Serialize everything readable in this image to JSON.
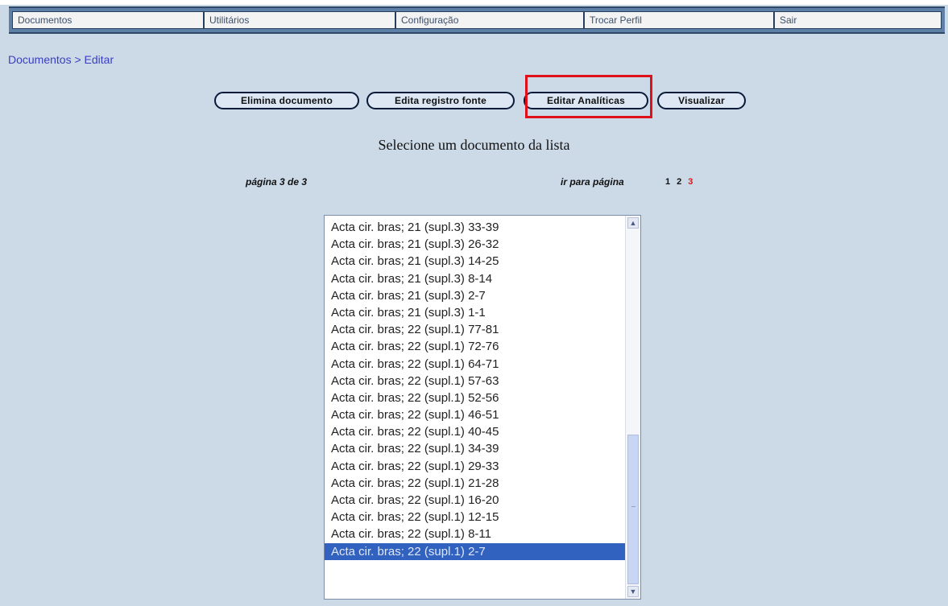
{
  "nav": {
    "items": [
      {
        "label": "Documentos"
      },
      {
        "label": "Utilitários"
      },
      {
        "label": "Configuração"
      },
      {
        "label": "Trocar Perfil"
      },
      {
        "label": "Sair"
      }
    ]
  },
  "breadcrumb": "Documentos > Editar",
  "actions": {
    "delete_label": "Elimina documento",
    "edit_source_label": "Edita registro fonte",
    "edit_analytics_label": "Editar Analíticas",
    "view_label": "Visualizar"
  },
  "heading": "Selecione um documento da lista",
  "pagination": {
    "page_info": "página 3 de 3",
    "goto_label": "ir para página",
    "pages": [
      "1",
      "2",
      "3"
    ],
    "current": "3"
  },
  "list": {
    "items": [
      "Acta cir. bras; 21 (supl.3) 33-39",
      "Acta cir. bras; 21 (supl.3) 26-32",
      "Acta cir. bras; 21 (supl.3) 14-25",
      "Acta cir. bras; 21 (supl.3) 8-14",
      "Acta cir. bras; 21 (supl.3) 2-7",
      "Acta cir. bras; 21 (supl.3) 1-1",
      "Acta cir. bras; 22 (supl.1) 77-81",
      "Acta cir. bras; 22 (supl.1) 72-76",
      "Acta cir. bras; 22 (supl.1) 64-71",
      "Acta cir. bras; 22 (supl.1) 57-63",
      "Acta cir. bras; 22 (supl.1) 52-56",
      "Acta cir. bras; 22 (supl.1) 46-51",
      "Acta cir. bras; 22 (supl.1) 40-45",
      "Acta cir. bras; 22 (supl.1) 34-39",
      "Acta cir. bras; 22 (supl.1) 29-33",
      "Acta cir. bras; 22 (supl.1) 21-28",
      "Acta cir. bras; 22 (supl.1) 16-20",
      "Acta cir. bras; 22 (supl.1) 12-15",
      "Acta cir. bras; 22 (supl.1) 8-11",
      "Acta cir. bras; 22 (supl.1) 2-7"
    ],
    "selected_index": 19
  },
  "colors": {
    "background": "#ccdae8",
    "nav_bar": "#5e7fa6",
    "selection": "#3162c0",
    "highlight_box": "#e0101a",
    "current_page": "#d21a1a"
  },
  "icons": {
    "scroll_up": "arrow-up-icon",
    "scroll_down": "arrow-down-icon"
  }
}
